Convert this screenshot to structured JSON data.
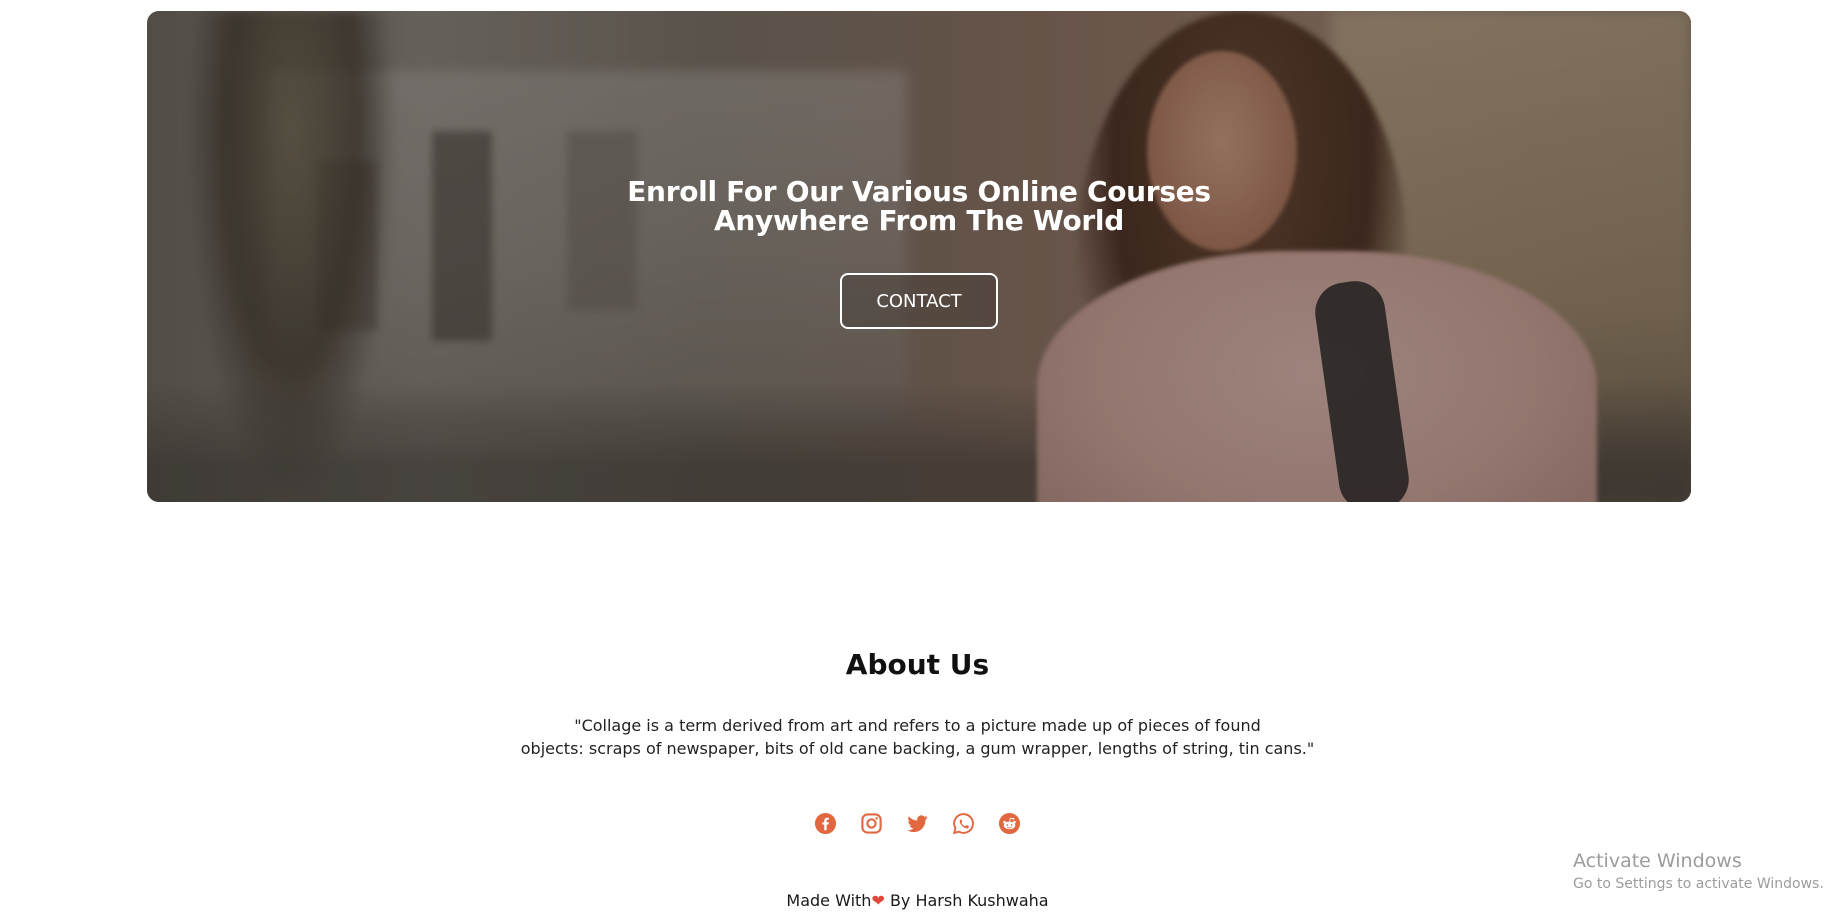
{
  "hero": {
    "headline_line1": "Enroll For Our Various Online Courses",
    "headline_line2": "Anywhere From The World",
    "contact_label": "CONTACT"
  },
  "about": {
    "title": "About Us",
    "text_line1": "\"Collage is a term derived from art and refers to a picture made up of pieces of found",
    "text_line2": "objects: scraps of newspaper, bits of old cane backing, a gum wrapper, lengths of string, tin cans.\""
  },
  "social": {
    "icons": [
      "facebook-icon",
      "instagram-icon",
      "twitter-icon",
      "whatsapp-icon",
      "reddit-icon"
    ],
    "accent_color": "#e0673f"
  },
  "footer": {
    "made_with": "Made With",
    "heart": "❤",
    "by": "By Harsh Kushwaha"
  },
  "watermark": {
    "title": "Activate Windows",
    "subtitle": "Go to Settings to activate Windows."
  }
}
